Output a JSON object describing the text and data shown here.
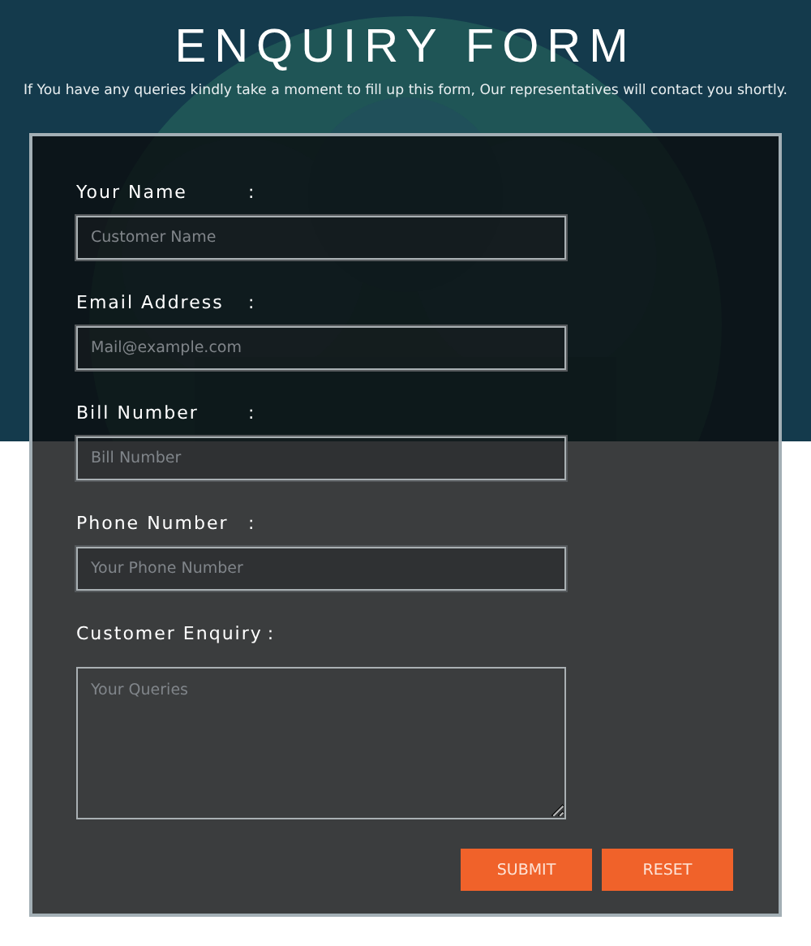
{
  "header": {
    "title": "ENQUIRY FORM",
    "subtitle": "If You have any queries kindly take a moment to fill up this form, Our representatives will contact you shortly."
  },
  "fields": [
    {
      "kind": "input",
      "label": "Your Name",
      "colon": ":",
      "placeholder": "Customer Name"
    },
    {
      "kind": "input",
      "label": "Email Address",
      "colon": ":",
      "placeholder": "Mail@example.com"
    },
    {
      "kind": "input",
      "label": "Bill Number",
      "colon": ":",
      "placeholder": "Bill Number"
    },
    {
      "kind": "input",
      "label": "Phone Number",
      "colon": ":",
      "placeholder": "Your Phone Number"
    },
    {
      "kind": "textarea",
      "label": "Customer Enquiry",
      "colon": ":",
      "placeholder": "Your Queries"
    }
  ],
  "buttons": [
    "SUBMIT",
    "RESET"
  ]
}
